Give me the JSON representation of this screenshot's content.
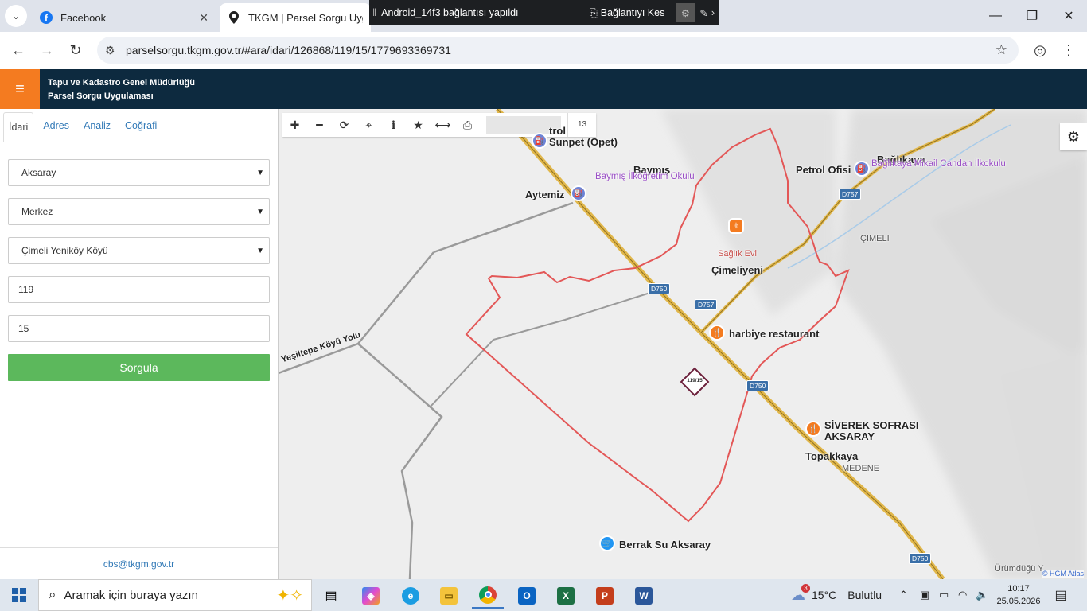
{
  "browser": {
    "tabs": [
      {
        "title": "Facebook",
        "active": false
      },
      {
        "title": "TKGM | Parsel Sorgu Uygulan",
        "active": true
      }
    ],
    "url": "parselsorgu.tkgm.gov.tr/#ara/idari/126868/119/15/1779693369731"
  },
  "remote_bar": {
    "status": "Android_14f3 bağlantısı yapıldı",
    "disconnect_label": "Bağlantıyı Kes"
  },
  "app": {
    "title_line1": "Tapu ve Kadastro Genel Müdürlüğü",
    "title_line2": "Parsel Sorgu Uygulaması",
    "accent_color": "#f47b20",
    "header_color": "#0d2a3f"
  },
  "sidebar": {
    "tabs": [
      "İdari",
      "Adres",
      "Analiz",
      "Coğrafi"
    ],
    "active_tab": "İdari",
    "il": "Aksaray",
    "ilce": "Merkez",
    "mahalle": "Çimeli Yeniköy Köyü",
    "ada": "119",
    "parsel": "15",
    "submit_label": "Sorgula",
    "submit_color": "#5cb85c",
    "contact_email": "cbs@tkgm.gov.tr"
  },
  "map": {
    "zoom_level": "13",
    "parcel_label": "119/15",
    "attribution": "© HGM Atlas",
    "labels": {
      "sunpet": "Sunpet (Opet)",
      "petrol_top": "trol",
      "baymis": "Baymış",
      "baymis_school": "Baymış İlköğretim Okulu",
      "aytemiz": "Aytemiz",
      "petrol_ofisi": "Petrol Ofisi",
      "baglikaya": "Bağlıkaya",
      "baglikaya_school": "Bağlıkaya Mikail Candan İlkokulu",
      "cimeli": "ÇIMELI",
      "saglik_evi": "Sağlık Evi",
      "cimeliyeni": "Çimeliyeni",
      "harbiye": "harbiye restaurant",
      "yesiltepe": "Yeşiltepe Köyü Yolu",
      "siverek1": "SİVEREK SOFRASI",
      "siverek2": "AKSARAY",
      "topakkaya": "Topakkaya",
      "medene": "MEDENE",
      "berrak": "Berrak Su Aksaray",
      "urumdugu": "Ürümdüğü Y"
    },
    "road_shields": [
      "D757",
      "D750",
      "D757",
      "D750",
      "D750"
    ]
  },
  "taskbar": {
    "search_placeholder": "Aramak için buraya yazın",
    "weather_temp": "15°C",
    "weather_desc": "Bulutlu",
    "weather_badge": "3",
    "time": "10:17",
    "date": "25.05.2026"
  }
}
